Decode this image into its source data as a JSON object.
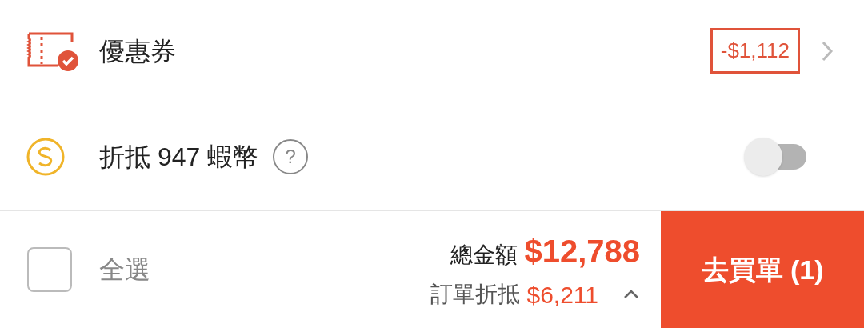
{
  "coupon": {
    "label": "優惠券",
    "discount": "-$1,112"
  },
  "coins": {
    "label": "折抵 947 蝦幣",
    "help": "?",
    "on": false
  },
  "footer": {
    "select_all": {
      "label": "全選",
      "checked": false
    },
    "total_label": "總金額",
    "total": "$12,788",
    "order_discount_label": "訂單折抵",
    "order_discount": "$6,211",
    "checkout": "去買單 (1)"
  }
}
